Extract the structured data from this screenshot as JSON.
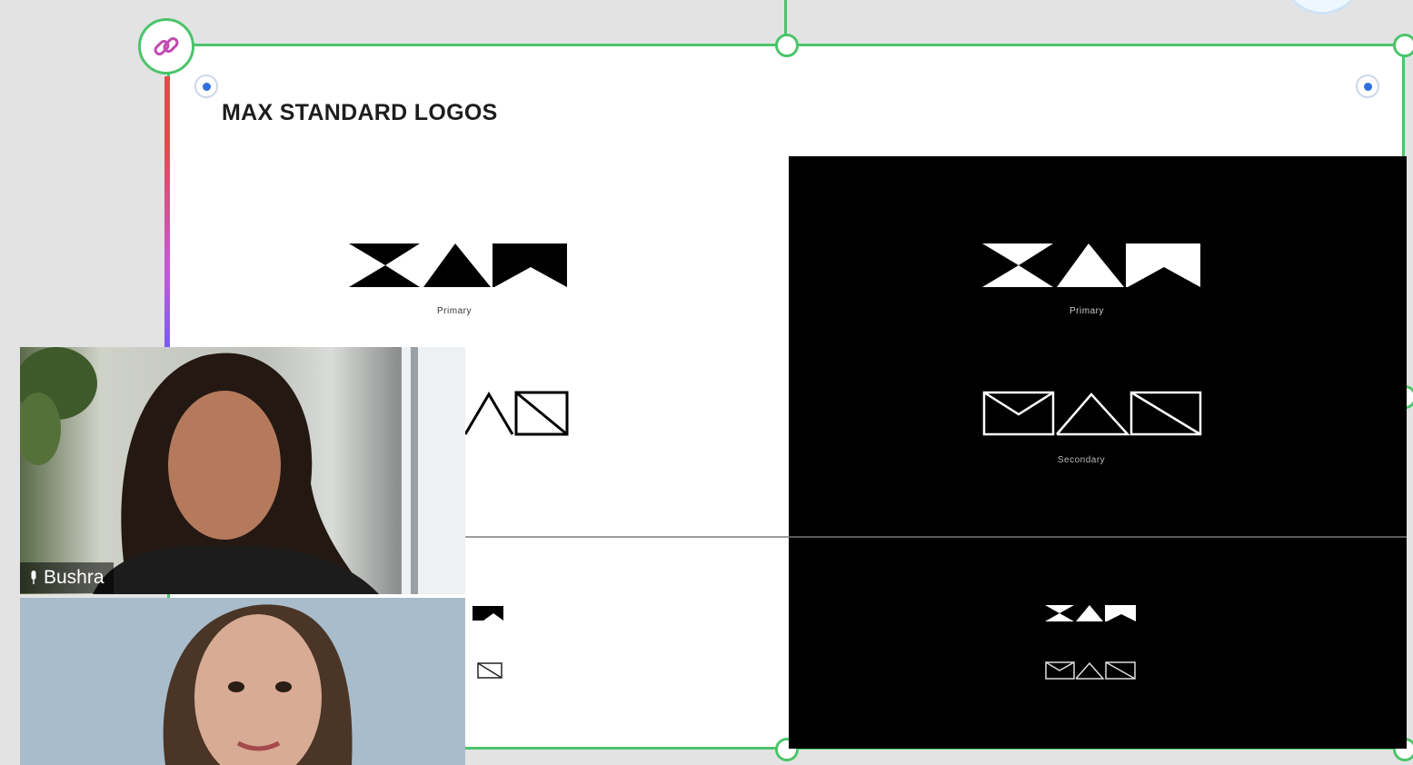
{
  "board": {
    "title": "MAX STANDARD LOGOS"
  },
  "logos": {
    "light_primary_caption": "Primary",
    "dark_primary_caption": "Primary",
    "dark_secondary_caption": "Secondary"
  },
  "participants": [
    {
      "name": "Bushra",
      "mic_icon": "microphone-icon"
    },
    {
      "name": ""
    }
  ],
  "icons": {
    "link": "link-icon",
    "settings": "gear-icon"
  },
  "colors": {
    "selection": "#4cc46a",
    "anchor": "#2f6fdf",
    "dark_panel": "#000000"
  }
}
